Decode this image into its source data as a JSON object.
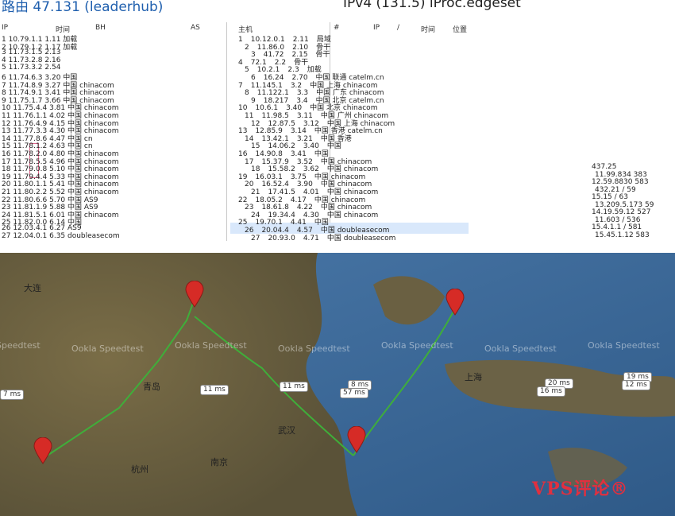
{
  "top_panel": {
    "left_title": "路由 47.131 (leaderhub)",
    "right_title": "IPv4 (131.5) iProc.edgeset",
    "left_headers": [
      "IP",
      "时间",
      "BH",
      "AS",
      "主机"
    ],
    "right_headers": [
      "#",
      "IP",
      "/",
      "时间",
      "位置"
    ],
    "left_rows": [
      "1  10.79.1.1    1.11  加载",
      "2  10.79.1.2    1.17  加载",
      "3  11.73.1.5    2.13",
      "4  11.73.2.8    2.16",
      "5  11.73.3.2    2.54",
      "6  11.74.6.3    3.20  中国",
      "7  11.74.8.9    3.27  中国 chinacom",
      "8  11.74.9.1    3.41  中国 chinacom",
      "9  11.75.1.7    3.66  中国 chinacom",
      "10 11.75.4.4    3.81  中国 chinacom",
      "11 11.76.1.1    4.02  中国 chinacom",
      "12 11.76.4.9    4.15  中国 chinacom",
      "13 11.77.3.3    4.30  中国 chinacom",
      "14 11.77.8.6    4.47  中国 cn",
      "15 11.78.1.2    4.63  中国 cn",
      "16 11.78.2.0    4.80  中国 chinacom",
      "17 11.78.5.5    4.96  中国 chinacom",
      "18 11.79.0.8    5.10  中国 chinacom",
      "19 11.79.4.4    5.33  中国 chinacom",
      "20 11.80.1.1    5.41  中国 chinacom",
      "21 11.80.2.2    5.52  中国 chinacom",
      "22 11.80.6.6    5.70  中国 AS9",
      "23 11.81.1.9    5.88  中国 AS9",
      "24 11.81.5.1    6.01  中国 chinacom",
      "25 11.82.0.0    6.14  中国",
      "26 12.03.4.1    6.27  AS9",
      "27 12.04.0.1    6.35  doubleasecom"
    ],
    "right_rows": [
      {
        "n": "1",
        "ip": "10.12.0.1",
        "t": "2.11",
        "loc": "局域"
      },
      {
        "n": "2",
        "ip": "11.86.0",
        "t": "2.10",
        "loc": "骨干"
      },
      {
        "n": "3",
        "ip": "41.72",
        "t": "2.15",
        "loc": "骨干"
      },
      {
        "n": "4",
        "ip": "72.1",
        "t": "2.2",
        "loc": "骨干"
      },
      {
        "n": "5",
        "ip": "10.2.1",
        "t": "2.3",
        "loc": "加载"
      },
      {
        "n": "6",
        "ip": "16.24",
        "t": "2.70",
        "loc": "中国 联通 catelm.cn"
      },
      {
        "n": "7",
        "ip": "11.145.1",
        "t": "3.2",
        "loc": "中国 上海 chinacom"
      },
      {
        "n": "8",
        "ip": "11.122.1",
        "t": "3.3",
        "loc": "中国 广东 chinacom"
      },
      {
        "n": "9",
        "ip": "18.217",
        "t": "3.4",
        "loc": "中国 北京 catelm.cn"
      },
      {
        "n": "10",
        "ip": "10.6.1",
        "t": "3.40",
        "loc": "中国 北京 chinacom"
      },
      {
        "n": "11",
        "ip": "11.98.5",
        "t": "3.11",
        "loc": "中国 广州 chinacom"
      },
      {
        "n": "12",
        "ip": "12.87.5",
        "t": "3.12",
        "loc": "中国 上海 chinacom"
      },
      {
        "n": "13",
        "ip": "12.85.9",
        "t": "3.14",
        "loc": "中国 香港 catelm.cn"
      },
      {
        "n": "14",
        "ip": "13.42.1",
        "t": "3.21",
        "loc": "中国 香港"
      },
      {
        "n": "15",
        "ip": "14.06.2",
        "t": "3.40",
        "loc": "中国"
      },
      {
        "n": "16",
        "ip": "14.90.8",
        "t": "3.41",
        "loc": "中国"
      },
      {
        "n": "17",
        "ip": "15.37.9",
        "t": "3.52",
        "loc": "中国 chinacom"
      },
      {
        "n": "18",
        "ip": "15.58.2",
        "t": "3.62",
        "loc": "中国 chinacom"
      },
      {
        "n": "19",
        "ip": "16.03.1",
        "t": "3.75",
        "loc": "中国 chinacom"
      },
      {
        "n": "20",
        "ip": "16.52.4",
        "t": "3.90",
        "loc": "中国 chinacom"
      },
      {
        "n": "21",
        "ip": "17.41.5",
        "t": "4.01",
        "loc": "中国 chinacom"
      },
      {
        "n": "22",
        "ip": "18.05.2",
        "t": "4.17",
        "loc": "中国 chinacom"
      },
      {
        "n": "23",
        "ip": "18.61.8",
        "t": "4.22",
        "loc": "中国 chinacom"
      },
      {
        "n": "24",
        "ip": "19.34.4",
        "t": "4.30",
        "loc": "中国 chinacom"
      },
      {
        "n": "25",
        "ip": "19.70.1",
        "t": "4.41",
        "loc": "中国"
      },
      {
        "n": "26",
        "ip": "20.04.4",
        "t": "4.57",
        "loc": "中国 doubleasecom"
      },
      {
        "n": "27",
        "ip": "20.93.0",
        "t": "4.71",
        "loc": "中国 doubleasecom"
      }
    ],
    "far_right_values": [
      "437.25",
      "11.99.834  383",
      "12.59.8830  583",
      "432.21  / 59",
      "15.15  / 63",
      "13.209.5.173  59",
      "14.19.59.12  527",
      "11.603  / 536",
      "15.4.1.1  / 581",
      "15.45.1.12  583"
    ]
  },
  "map": {
    "watermark_text": "Ookla Speedtest",
    "cities": [
      "大连",
      "青岛",
      "上海",
      "南京",
      "武汉",
      "杭州"
    ],
    "badges": [
      "7 ms",
      "11 ms",
      "11 ms",
      "8 ms",
      "57 ms",
      "20 ms",
      "16 ms",
      "19 ms",
      "12 ms"
    ],
    "pins_count": 4
  },
  "logo": {
    "text": "VPS评论®"
  },
  "colors": {
    "route": "#3fae3a",
    "pin": "#d62b26",
    "sea": "#3f6a9a",
    "land": "#6d6344",
    "logo": "#e0303f"
  }
}
